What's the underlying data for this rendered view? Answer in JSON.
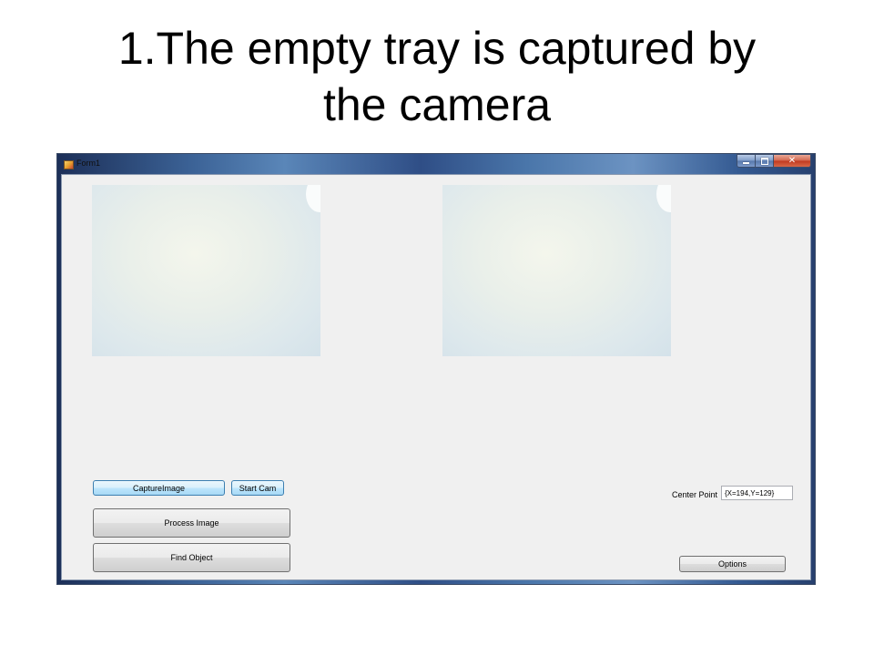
{
  "slide": {
    "title_line1": "1.The empty tray is captured by",
    "title_line2": "the camera"
  },
  "window": {
    "title": "Form1",
    "icon": "form-app-icon",
    "caption_buttons": [
      "minimize-icon",
      "maximize-icon",
      "close-icon"
    ],
    "close_glyph": "✕"
  },
  "form": {
    "capture_button": "CaptureImage",
    "start_cam_button": "Start Cam",
    "process_button": "Process Image",
    "find_button": "Find Object",
    "center_point_label": "Center Point",
    "center_point_value": "{X=194,Y=129}",
    "options_button": "Options"
  },
  "colors": {
    "form_background": "#f0f0f0",
    "focused_button": "#bee6fd",
    "close_button": "#c0391f"
  }
}
